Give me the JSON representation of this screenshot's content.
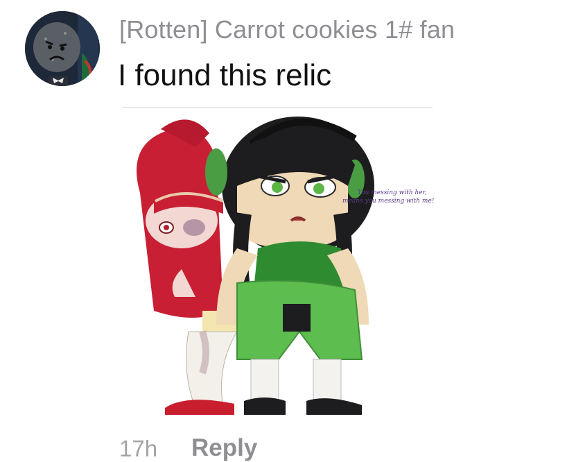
{
  "comment": {
    "author": "[Rotten] Carrot cookies 1# fan",
    "text": "I found this relic",
    "image_caption": [
      "You messing with her,",
      "means you messing with me!"
    ],
    "time": "17h",
    "reply_label": "Reply"
  },
  "icons": {
    "avatar": "avatar-icon",
    "attached_image": "drawing-image"
  },
  "colors": {
    "username": "#8e8e93",
    "text": "#111111",
    "meta": "#a3a3a8"
  }
}
